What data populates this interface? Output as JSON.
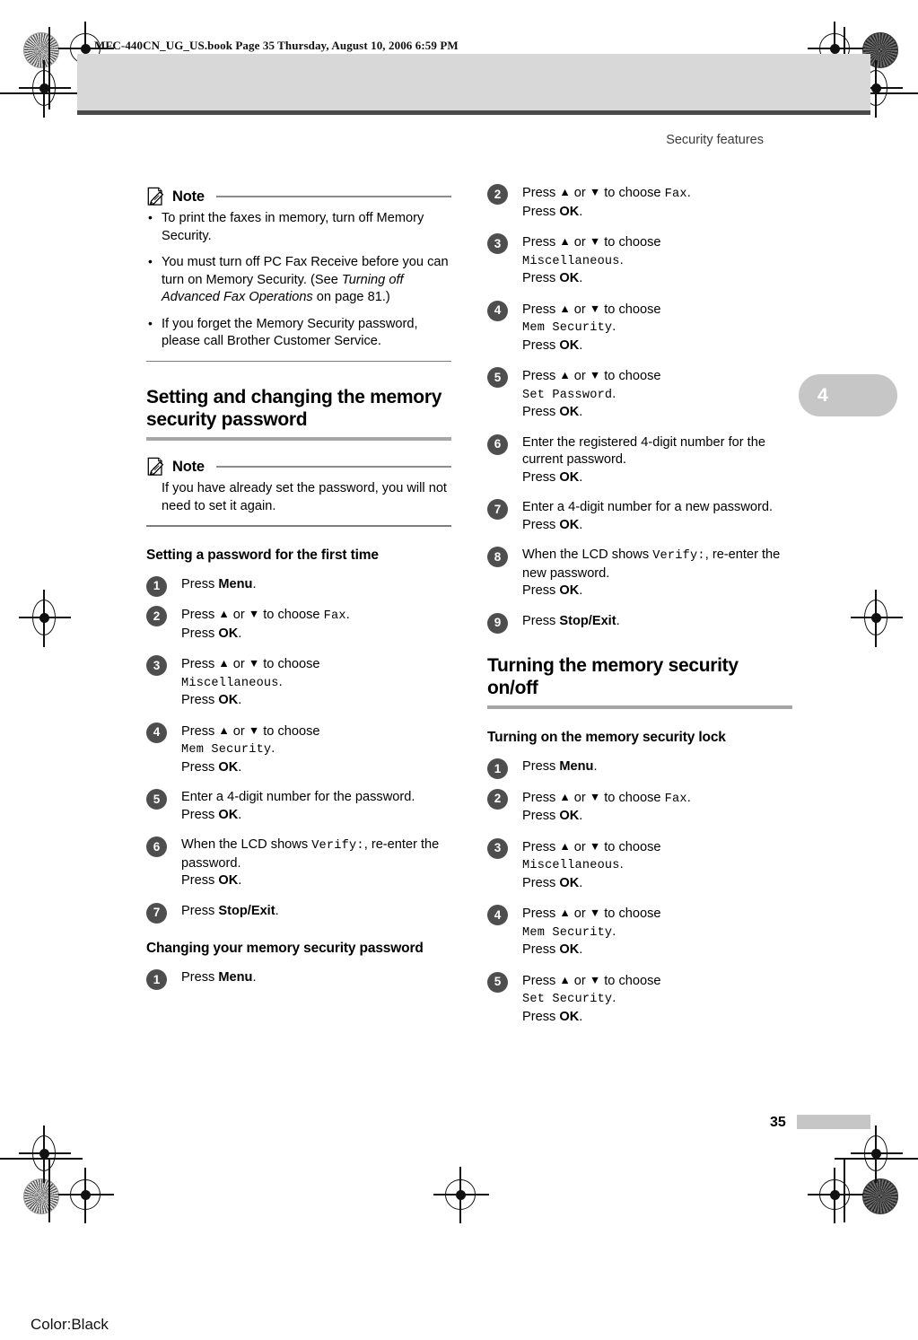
{
  "print_marks": {
    "book_header": "MFC-440CN_UG_US.book  Page 35  Thursday, August 10, 2006  6:59 PM",
    "color_note": "Color:Black"
  },
  "running_head": "Security features",
  "chapter_tab": "4",
  "page_number": "35",
  "left_column": {
    "note_top": {
      "title": "Note",
      "bullets": [
        "To print the faxes in memory, turn off Memory Security.",
        "You must turn off PC Fax Receive before you can turn on Memory Security. (See ",
        "If you forget the Memory Security password, please call Brother Customer Service."
      ],
      "bullet2_italic": "Turning off Advanced Fax Operations",
      "bullet2_tail": " on page 81.)"
    },
    "heading": "Setting and changing the memory security password",
    "note_second": {
      "title": "Note",
      "text": "If you have already set the password, you will not need to set it again."
    },
    "subheading_1": "Setting a password for the first time",
    "steps_1": [
      {
        "num": "1",
        "lines": [
          {
            "t": "Press ",
            "b": "Menu",
            "tail": "."
          }
        ]
      },
      {
        "num": "2",
        "lines": [
          {
            "t": "Press ",
            "arrows": true,
            "mid": " to choose ",
            "code": "Fax",
            "tail": "."
          },
          {
            "t": "Press ",
            "b": "OK",
            "tail": "."
          }
        ]
      },
      {
        "num": "3",
        "lines": [
          {
            "t": "Press ",
            "arrows": true,
            "mid": " to choose"
          },
          {
            "code": "Miscellaneous",
            "tail": "."
          },
          {
            "t": "Press ",
            "b": "OK",
            "tail": "."
          }
        ]
      },
      {
        "num": "4",
        "lines": [
          {
            "t": "Press ",
            "arrows": true,
            "mid": " to choose"
          },
          {
            "code": "Mem Security",
            "tail": "."
          },
          {
            "t": "Press ",
            "b": "OK",
            "tail": "."
          }
        ]
      },
      {
        "num": "5",
        "lines": [
          {
            "t": "Enter a 4-digit number for the password."
          },
          {
            "t": "Press ",
            "b": "OK",
            "tail": "."
          }
        ]
      },
      {
        "num": "6",
        "lines": [
          {
            "t": "When the LCD shows ",
            "code": "Verify:",
            "tail": ", re-enter the password."
          },
          {
            "t": "Press ",
            "b": "OK",
            "tail": "."
          }
        ]
      },
      {
        "num": "7",
        "lines": [
          {
            "t": "Press ",
            "b": "Stop/Exit",
            "tail": "."
          }
        ]
      }
    ],
    "subheading_2": "Changing your memory security password",
    "steps_2": [
      {
        "num": "1",
        "lines": [
          {
            "t": "Press ",
            "b": "Menu",
            "tail": "."
          }
        ]
      }
    ]
  },
  "right_column": {
    "steps_continued": [
      {
        "num": "2",
        "lines": [
          {
            "t": "Press ",
            "arrows": true,
            "mid": " to choose ",
            "code": "Fax",
            "tail": "."
          },
          {
            "t": "Press ",
            "b": "OK",
            "tail": "."
          }
        ]
      },
      {
        "num": "3",
        "lines": [
          {
            "t": "Press ",
            "arrows": true,
            "mid": " to choose"
          },
          {
            "code": "Miscellaneous",
            "tail": "."
          },
          {
            "t": "Press ",
            "b": "OK",
            "tail": "."
          }
        ]
      },
      {
        "num": "4",
        "lines": [
          {
            "t": "Press ",
            "arrows": true,
            "mid": " to choose"
          },
          {
            "code": "Mem Security",
            "tail": "."
          },
          {
            "t": "Press ",
            "b": "OK",
            "tail": "."
          }
        ]
      },
      {
        "num": "5",
        "lines": [
          {
            "t": "Press ",
            "arrows": true,
            "mid": " to choose"
          },
          {
            "code": "Set Password",
            "tail": "."
          },
          {
            "t": "Press ",
            "b": "OK",
            "tail": "."
          }
        ]
      },
      {
        "num": "6",
        "lines": [
          {
            "t": "Enter the registered 4-digit number for the current password."
          },
          {
            "t": "Press ",
            "b": "OK",
            "tail": "."
          }
        ]
      },
      {
        "num": "7",
        "lines": [
          {
            "t": "Enter a 4-digit number for a new password."
          },
          {
            "t": "Press ",
            "b": "OK",
            "tail": "."
          }
        ]
      },
      {
        "num": "8",
        "lines": [
          {
            "t": "When the LCD shows ",
            "code": "Verify:",
            "tail": ", re-enter the new password."
          },
          {
            "t": "Press ",
            "b": "OK",
            "tail": "."
          }
        ]
      },
      {
        "num": "9",
        "lines": [
          {
            "t": "Press ",
            "b": "Stop/Exit",
            "tail": "."
          }
        ]
      }
    ],
    "heading": "Turning the memory security on/off",
    "subheading": "Turning on the memory security lock",
    "steps_lock": [
      {
        "num": "1",
        "lines": [
          {
            "t": "Press ",
            "b": "Menu",
            "tail": "."
          }
        ]
      },
      {
        "num": "2",
        "lines": [
          {
            "t": "Press ",
            "arrows": true,
            "mid": " to choose ",
            "code": "Fax",
            "tail": "."
          },
          {
            "t": "Press ",
            "b": "OK",
            "tail": "."
          }
        ]
      },
      {
        "num": "3",
        "lines": [
          {
            "t": "Press ",
            "arrows": true,
            "mid": " to choose"
          },
          {
            "code": "Miscellaneous",
            "tail": "."
          },
          {
            "t": "Press ",
            "b": "OK",
            "tail": "."
          }
        ]
      },
      {
        "num": "4",
        "lines": [
          {
            "t": "Press ",
            "arrows": true,
            "mid": " to choose"
          },
          {
            "code": "Mem Security",
            "tail": "."
          },
          {
            "t": "Press ",
            "b": "OK",
            "tail": "."
          }
        ]
      },
      {
        "num": "5",
        "lines": [
          {
            "t": "Press ",
            "arrows": true,
            "mid": " to choose"
          },
          {
            "code": "Set Security",
            "tail": "."
          },
          {
            "t": "Press ",
            "b": "OK",
            "tail": "."
          }
        ]
      }
    ]
  },
  "colors": {
    "banner_gray": "#d8d8d8",
    "banner_rule": "#4a4a4a",
    "badge_gray": "#4e4e4e",
    "tab_gray": "#c6c6c6",
    "heading_rule": "#a6a6a6"
  }
}
